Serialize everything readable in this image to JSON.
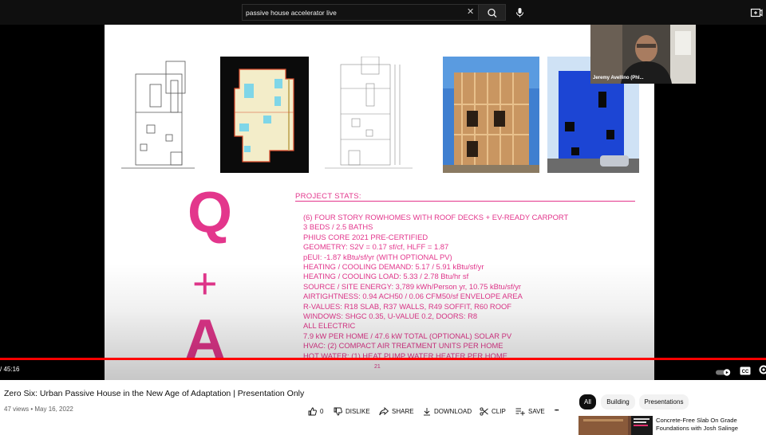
{
  "search": {
    "query": "passive house accelerator live",
    "clear_glyph": "✕"
  },
  "icons": {
    "search": "search-icon",
    "mic": "mic-icon",
    "create": "create-icon",
    "autoplay": "autoplay-toggle-icon",
    "captions": "captions-icon",
    "settings": "gear-icon"
  },
  "player": {
    "time_display": "/ 45:16",
    "progress_fraction": 1.0,
    "webcam_name": "Jeremy Avellino (Phl..."
  },
  "slide": {
    "q": "Q",
    "plus": "+",
    "a": "A",
    "stats_title": "PROJECT STATS:",
    "stats": [
      "(6) FOUR STORY ROWHOMES WITH ROOF DECKS + EV-READY CARPORT",
      "3 BEDS / 2.5 BATHS",
      "PHIUS CORE 2021 PRE-CERTIFIED",
      "GEOMETRY: S2V = 0.17 sf/cf, HLFF = 1.87",
      "pEUI: -1.87 kBtu/sf/yr (WITH OPTIONAL PV)",
      "HEATING / COOLING DEMAND: 5.17 / 5.91 kBtu/sf/yr",
      "HEATING / COOLING LOAD: 5.33 / 2.78 Btu/hr sf",
      "SOURCE / SITE ENERGY: 3,789 kWh/Person yr, 10.75 kBtu/sf/yr",
      "AIRTIGHTNESS: 0.94 ACH50 / 0.06 CFM50/sf ENVELOPE AREA",
      "R-VALUES: R18 SLAB, R37 WALLS, R49 SOFFIT, R60 ROOF",
      "WINDOWS: SHGC 0.35, U-VALUE 0.2, DOORS: R8",
      "ALL ELECTRIC",
      "7.9 kW PER HOME / 47.6 kW TOTAL (OPTIONAL) SOLAR PV",
      "HVAC: (2) COMPACT AIR TREATMENT UNITS PER HOME",
      "HOT WATER: (1) HEAT PUMP WATER HEATER PER HOME"
    ],
    "page_number": "21"
  },
  "video": {
    "title": "Zero Six: Urban Passive House in the New Age of Adaptation | Presentation Only",
    "meta": "47 views • May 16, 2022"
  },
  "actions": {
    "like_count": "0",
    "dislike": "DISLIKE",
    "share": "SHARE",
    "download": "DOWNLOAD",
    "clip": "CLIP",
    "save": "SAVE",
    "more": "•••"
  },
  "chips": [
    "All",
    "Building",
    "Presentations"
  ],
  "recommendation": {
    "title": "Concrete-Free Slab On Grade Foundations with Josh Salinge"
  },
  "colors": {
    "accent_pink": "#e3368c",
    "progress_red": "#ff0000",
    "topbar": "#0f0f0f"
  }
}
